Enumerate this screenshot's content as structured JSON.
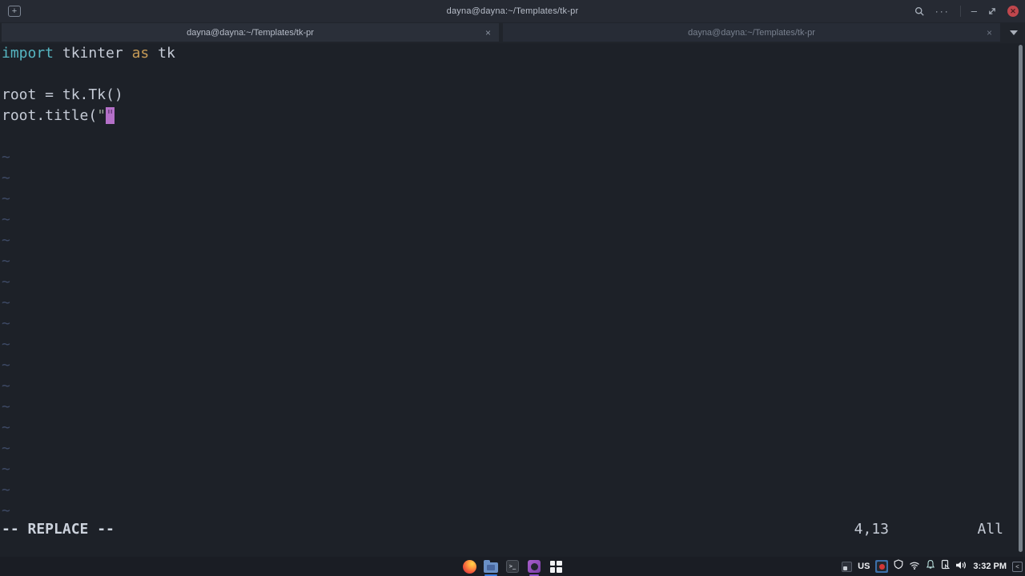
{
  "titlebar": {
    "title": "dayna@dayna:~/Templates/tk-pr",
    "new_tab_glyph": "+",
    "menu_glyph": "···",
    "minimize_glyph": "–",
    "close_glyph": "✕"
  },
  "tabbar": {
    "tabs": [
      {
        "label": "dayna@dayna:~/Templates/tk-pr",
        "close_glyph": "×",
        "active": true
      },
      {
        "label": "dayna@dayna:~/Templates/tk-pr",
        "close_glyph": "×",
        "active": false
      }
    ]
  },
  "editor": {
    "code_lines": [
      {
        "tokens": [
          {
            "text": "import",
            "style": "keyword"
          },
          {
            "text": " tkinter ",
            "style": "plain"
          },
          {
            "text": "as",
            "style": "keyword2"
          },
          {
            "text": " tk",
            "style": "plain"
          }
        ]
      },
      {
        "tokens": []
      },
      {
        "tokens": [
          {
            "text": "root = tk.Tk()",
            "style": "plain"
          }
        ]
      },
      {
        "tokens": [
          {
            "text": "root.title(",
            "style": "plain"
          },
          {
            "text": "\"",
            "style": "string"
          },
          {
            "text": "\"",
            "style": "cursor"
          }
        ]
      }
    ],
    "tilde_char": "~",
    "tilde_count": 18,
    "mode_indicator": "-- REPLACE --",
    "cursor_position": "4,13",
    "scroll_indicator": "All"
  },
  "taskbar": {
    "terminal_glyph": ">_",
    "tray": {
      "keyboard_layout": "US",
      "time": "3:32 PM",
      "hide_glyph": "<"
    }
  },
  "colors": {
    "accent_blue_indicator": "#3d7de0",
    "accent_purple_indicator": "#8f52c9",
    "close_button_red": "#c0474d",
    "cursor_block_magenta": "#b470c8",
    "keyword_cyan": "#56b6c2",
    "keyword_gold": "#c79b56",
    "tilde_blue": "#3e4a66"
  }
}
